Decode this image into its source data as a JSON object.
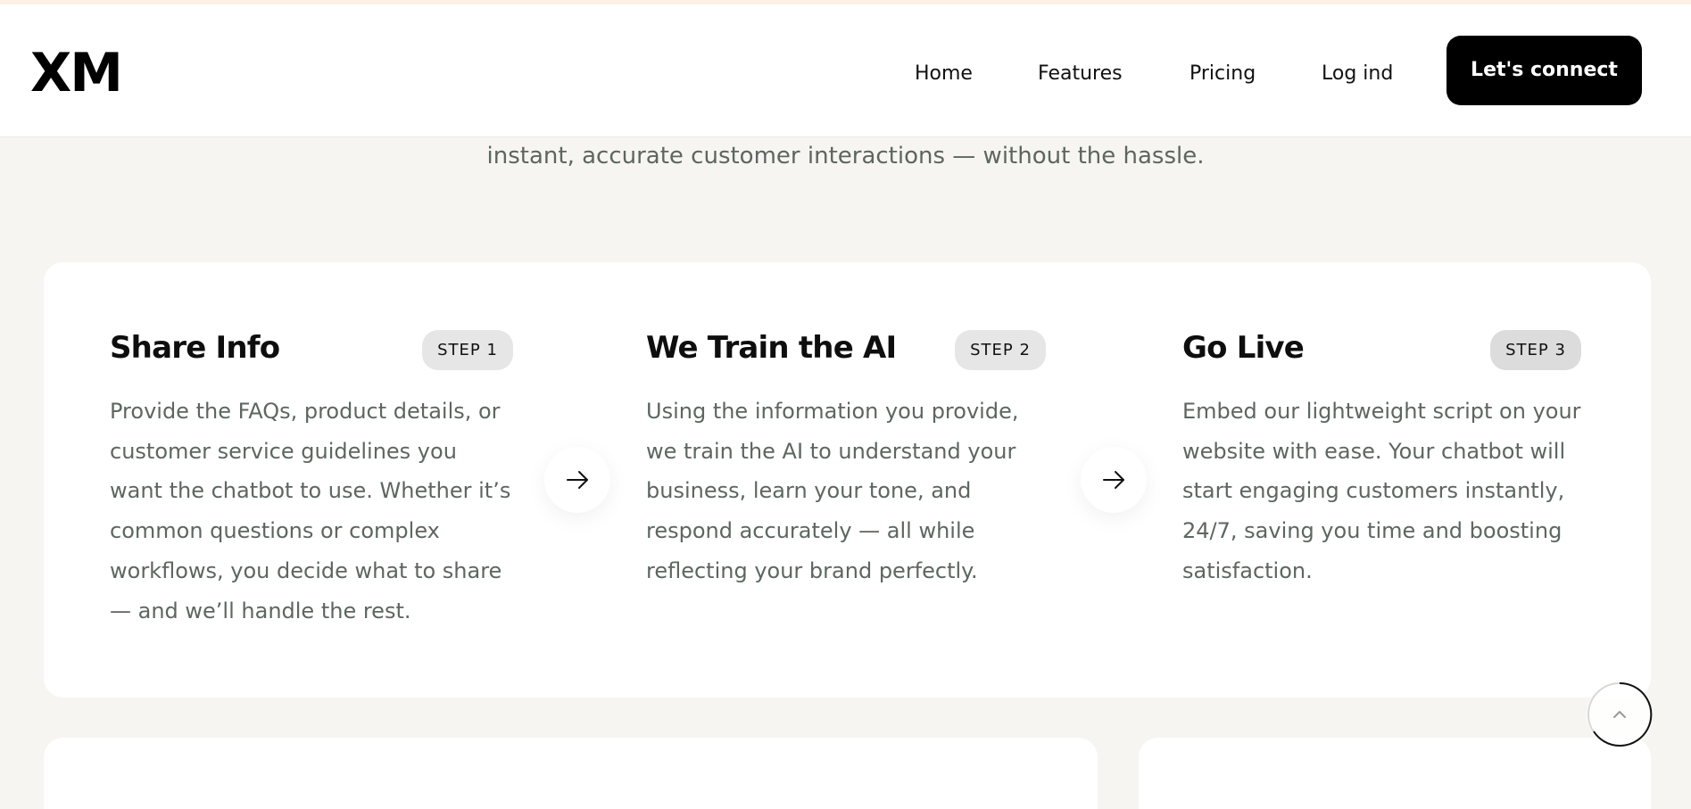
{
  "header": {
    "logo": "XM",
    "nav": [
      {
        "label": "Home"
      },
      {
        "label": "Features"
      },
      {
        "label": "Pricing"
      },
      {
        "label": "Log ind"
      }
    ],
    "cta_label": "Let's connect"
  },
  "hero": {
    "lead_visible_line": "instant, accurate customer interactions — without the hassle."
  },
  "steps": [
    {
      "title": "Share Info",
      "badge": "STEP 1",
      "description": "Provide the FAQs, product details, or customer service guidelines you want the chatbot to use. Whether it’s common questions or complex workflows, you decide what to share — and we’ll handle the rest."
    },
    {
      "title": "We Train the AI",
      "badge": "STEP 2",
      "description": "Using the information you provide, we train the AI to understand your business, learn your tone, and respond accurately — all while reflecting your brand perfectly."
    },
    {
      "title": "Go Live",
      "badge": "STEP 3",
      "description": "Embed our lightweight script on your website with ease. Your chatbot will start engaging customers instantly, 24/7, saving you time and boosting satisfaction."
    }
  ],
  "icons": {
    "step_arrow": "arrow-right-icon",
    "scroll_top": "chevron-up-icon"
  },
  "colors": {
    "page_bg": "#f6f5f2",
    "card_bg": "#ffffff",
    "cta_bg": "#000000",
    "body_text": "#5d6660",
    "badge_bg": "#e6e6e6"
  }
}
